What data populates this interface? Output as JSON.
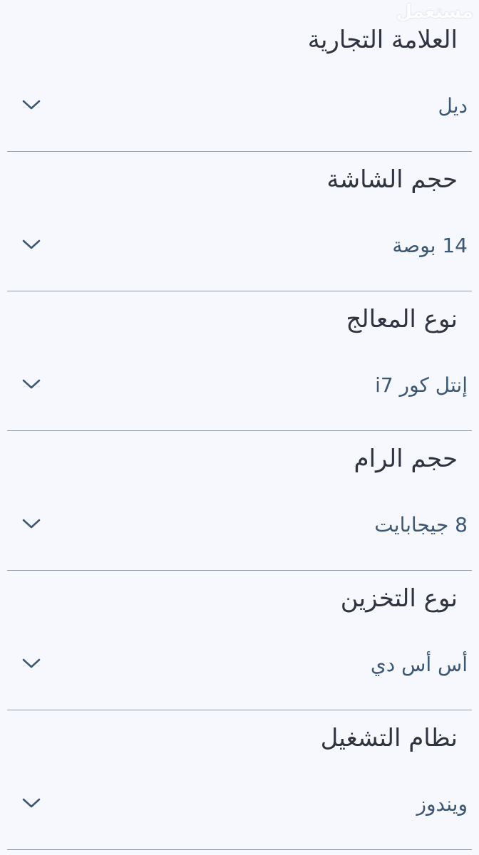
{
  "watermark": "مستعمل",
  "specs": [
    {
      "label": "العلامة التجارية",
      "value": "ديل"
    },
    {
      "label": "حجم الشاشة",
      "value": "14 بوصة"
    },
    {
      "label": "نوع المعالج",
      "value": "إنتل كور i7"
    },
    {
      "label": "حجم الرام",
      "value": "8 جيجابايت"
    },
    {
      "label": "نوع التخزين",
      "value": "أس أس دي"
    },
    {
      "label": "نظام التشغيل",
      "value": "ويندوز"
    }
  ],
  "icons": {
    "expand": "chevron-down-icon"
  },
  "colors": {
    "background": "#f7f8fd",
    "label": "#2f3440",
    "value": "#3b5878",
    "divider": "#8f96a3"
  }
}
